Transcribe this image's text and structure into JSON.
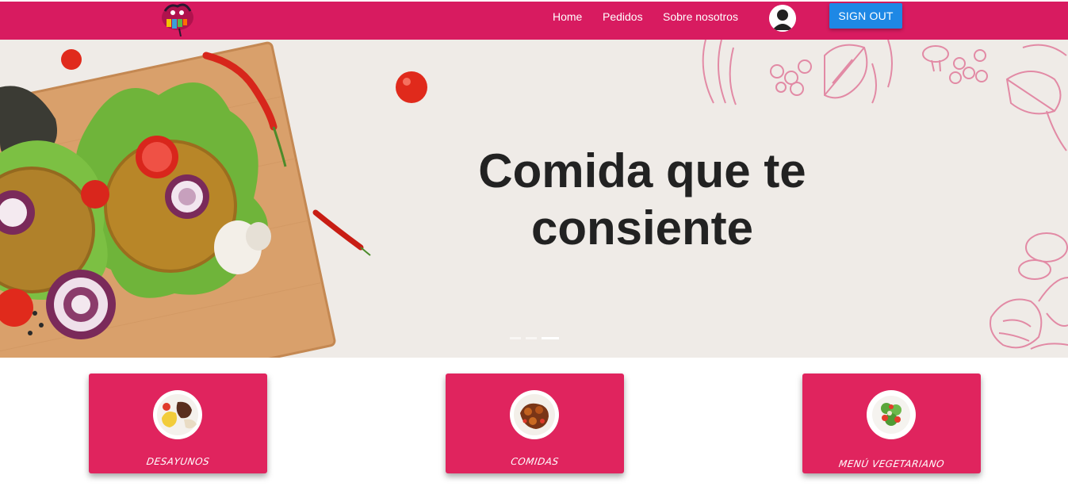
{
  "navbar": {
    "links": [
      {
        "label": "Home"
      },
      {
        "label": "Pedidos"
      },
      {
        "label": "Sobre nosotros"
      }
    ],
    "signout_label": "SIGN OUT",
    "colors": {
      "bar": "#d81b60",
      "signout": "#1e88e5"
    },
    "icons": {
      "logo": "brand-logo",
      "avatar": "user-avatar-icon"
    }
  },
  "hero": {
    "title_line1": "Comida que te",
    "title_line2": "consiente",
    "carousel": {
      "slides": 3,
      "active_index": 2
    },
    "background": "#efebe7"
  },
  "categories": [
    {
      "label": "DESAYUNOS",
      "icon": "breakfast-plate-icon"
    },
    {
      "label": "COMIDAS",
      "icon": "meals-plate-icon"
    },
    {
      "label": "MENÚ VEGETARIANO",
      "icon": "salad-plate-icon"
    }
  ],
  "card_color": "#e0245e"
}
